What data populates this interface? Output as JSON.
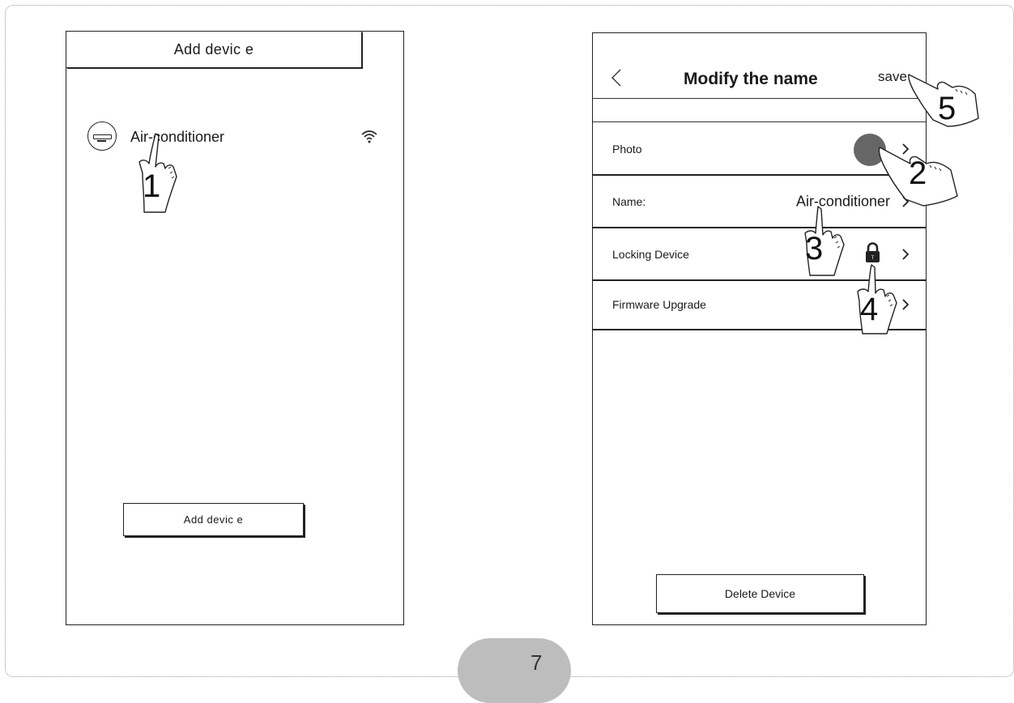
{
  "left_screen": {
    "header_title": "Add devic e",
    "device": {
      "name": "Air-conditioner",
      "icon": "air-conditioner-icon",
      "status_icon": "wifi-icon"
    },
    "add_button_label": "Add devic e",
    "step_label": "1"
  },
  "right_screen": {
    "title": "Modify the name",
    "save_label": "save",
    "back_icon": "chevron-left-icon",
    "rows": [
      {
        "label": "Photo",
        "value": "",
        "step": "2"
      },
      {
        "label": "Name:",
        "value": "Air-conditioner",
        "step": "3"
      },
      {
        "label": "Locking Device",
        "value": "",
        "step": "4"
      },
      {
        "label": "Firmware Upgrade",
        "value": ""
      }
    ],
    "save_step": "5",
    "delete_button_label": "Delete Device"
  },
  "page_number": "7",
  "colors": {
    "line": "#222222",
    "photo_placeholder": "#666666",
    "page_tab": "#bdbdbd"
  }
}
